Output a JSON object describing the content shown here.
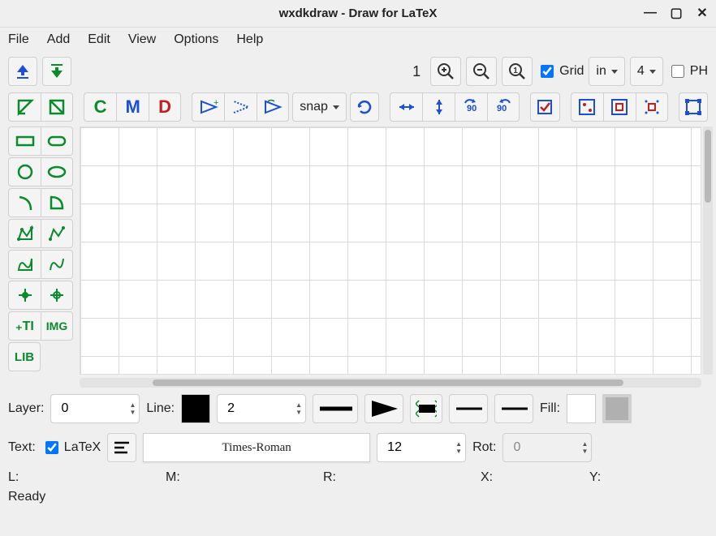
{
  "window": {
    "title": "wxdkdraw - Draw for LaTeX"
  },
  "menu": {
    "file": "File",
    "add": "Add",
    "edit": "Edit",
    "view": "View",
    "options": "Options",
    "help": "Help"
  },
  "zoom": {
    "value": "1"
  },
  "grid": {
    "label": "Grid",
    "checked": true,
    "unit": "in",
    "subdiv": "4"
  },
  "ph": {
    "label": "PH",
    "checked": false
  },
  "toolbar2": {
    "c": "C",
    "m": "M",
    "d": "D",
    "snap": "snap",
    "lib": "LIB",
    "ti": "TI",
    "img": "IMG"
  },
  "props": {
    "layer_label": "Layer:",
    "layer_value": "0",
    "line_label": "Line:",
    "line_width": "2",
    "fill_label": "Fill:",
    "text_label": "Text:",
    "latex_label": "LaTeX",
    "latex_checked": true,
    "font": "Times-Roman",
    "font_size": "12",
    "rot_label": "Rot:",
    "rot_value": "0"
  },
  "status": {
    "L": "L:",
    "M": "M:",
    "R": "R:",
    "X": "X:",
    "Y": "Y:",
    "ready": "Ready"
  }
}
